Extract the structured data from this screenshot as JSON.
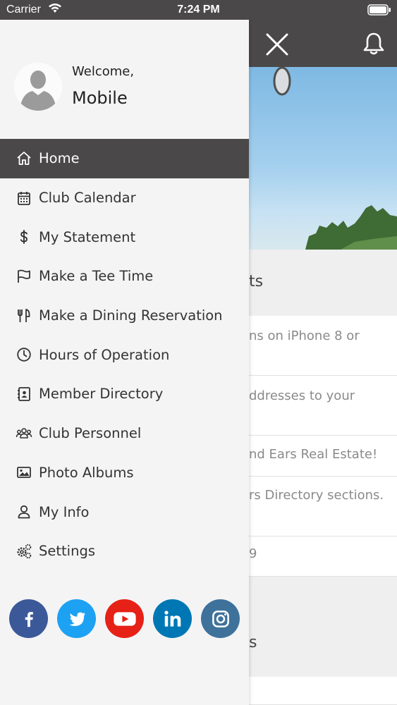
{
  "status_bar": {
    "carrier": "Carrier",
    "time": "7:24 PM"
  },
  "drawer": {
    "welcome": "Welcome,",
    "username": "Mobile",
    "menu": [
      {
        "label": "Home",
        "icon": "home-icon",
        "active": true
      },
      {
        "label": "Club Calendar",
        "icon": "calendar-icon"
      },
      {
        "label": "My Statement",
        "icon": "dollar-icon"
      },
      {
        "label": "Make a Tee Time",
        "icon": "flag-icon"
      },
      {
        "label": "Make a Dining Reservation",
        "icon": "utensils-icon"
      },
      {
        "label": "Hours of Operation",
        "icon": "clock-icon"
      },
      {
        "label": "Member Directory",
        "icon": "contact-book-icon"
      },
      {
        "label": "Club Personnel",
        "icon": "users-icon"
      },
      {
        "label": "Photo Albums",
        "icon": "image-icon"
      },
      {
        "label": "My Info",
        "icon": "user-icon"
      },
      {
        "label": "Settings",
        "icon": "cogs-icon"
      }
    ],
    "social": [
      {
        "name": "facebook",
        "color": "#3b5998"
      },
      {
        "name": "twitter",
        "color": "#1da1f2"
      },
      {
        "name": "youtube",
        "color": "#e62117"
      },
      {
        "name": "linkedin",
        "color": "#0077b5"
      },
      {
        "name": "instagram",
        "color": "#3f729b"
      }
    ]
  },
  "background_page": {
    "section1_heading_fragment": "ts",
    "items": [
      "ns on iPhone 8 or",
      "ddresses to your",
      "nd Ears Real Estate!",
      "rs Directory sections.",
      "9"
    ],
    "section2_heading_fragment": "s"
  },
  "colors": {
    "header": "#4a4848",
    "drawer_bg": "#f4f4f5",
    "active_item": "#4a4848"
  }
}
